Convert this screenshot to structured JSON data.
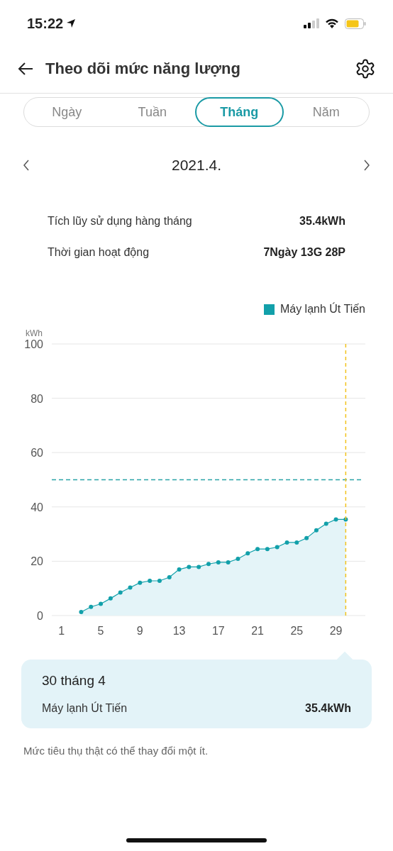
{
  "status_bar": {
    "time": "15:22"
  },
  "header": {
    "title": "Theo dõi mức năng lượng"
  },
  "tabs": [
    {
      "label": "Ngày",
      "selected": false
    },
    {
      "label": "Tuần",
      "selected": false
    },
    {
      "label": "Tháng",
      "selected": true
    },
    {
      "label": "Năm",
      "selected": false
    }
  ],
  "period": {
    "label": "2021.4."
  },
  "stats": [
    {
      "label": "Tích lũy sử dụng hàng tháng",
      "value": "35.4kWh"
    },
    {
      "label": "Thời gian hoạt động",
      "value": "7Ngày 13G 28P"
    }
  ],
  "chart": {
    "chart_data": {
      "type": "area",
      "ylabel": "kWh",
      "x": [
        3,
        4,
        5,
        6,
        7,
        8,
        9,
        10,
        11,
        12,
        13,
        14,
        15,
        16,
        17,
        18,
        19,
        20,
        21,
        22,
        23,
        24,
        25,
        26,
        27,
        28,
        29,
        30
      ],
      "xlim": [
        0,
        32
      ],
      "ylim": [
        0,
        100
      ],
      "xticks": [
        1,
        5,
        9,
        13,
        17,
        21,
        25,
        29
      ],
      "yticks": [
        0,
        20,
        40,
        60,
        80,
        100
      ],
      "series": [
        {
          "name": "Máy lạnh Út Tiến",
          "color": "#12a0aa",
          "values": [
            1.3,
            3.2,
            4.3,
            6.3,
            8.5,
            10.3,
            12.1,
            12.8,
            12.8,
            14.1,
            17.0,
            17.9,
            17.9,
            19.0,
            19.6,
            19.6,
            20.9,
            22.9,
            24.5,
            24.5,
            25.2,
            26.9,
            26.9,
            28.5,
            31.4,
            33.8,
            35.4,
            35.4
          ]
        }
      ],
      "grid": true,
      "ref_lines": [
        {
          "axis": "y",
          "value": 50,
          "color": "#2aa3a8"
        },
        {
          "axis": "x",
          "value": 30,
          "color": "#f2c21b"
        }
      ]
    }
  },
  "tooltip": {
    "date": "30 tháng 4",
    "name": "Máy lạnh Út Tiến",
    "value": "35.4kWh"
  },
  "footnote": "Mức tiêu thụ thật có thể thay đổi một ít."
}
